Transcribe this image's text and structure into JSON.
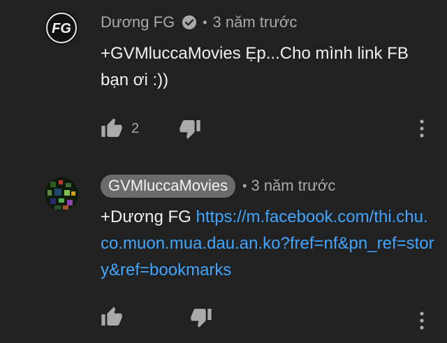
{
  "comments": [
    {
      "author": "Dương FG",
      "verified": true,
      "separator": "•",
      "time": "3 năm trước",
      "text": "+GVMluccaMovies Ẹp...Cho mình link FB bạn ơi :))",
      "like_count": "2",
      "avatar_icon": "fg-logo-avatar",
      "avatar_text": "FG"
    },
    {
      "author": "GVMluccaMovies",
      "verified": false,
      "separator": "•",
      "time": "3 năm trước",
      "mention": "+Dương FG",
      "link": "https://m.facebook.com/thi.chu.co.muon.mua.dau.an.ko?fref=nf&pn_ref=story&ref=bookmarks",
      "like_count": "",
      "avatar_icon": "pixel-art-avatar"
    }
  ],
  "colors": {
    "background": "#212121",
    "text_primary": "#f1f1f1",
    "text_secondary": "#aaaaaa",
    "link": "#3ea6ff",
    "author_chip": "#6b6b6b"
  },
  "icons": {
    "like": "thumb-up-icon",
    "dislike": "thumb-down-icon",
    "menu": "more-vert-icon",
    "verified": "verified-check-icon"
  }
}
